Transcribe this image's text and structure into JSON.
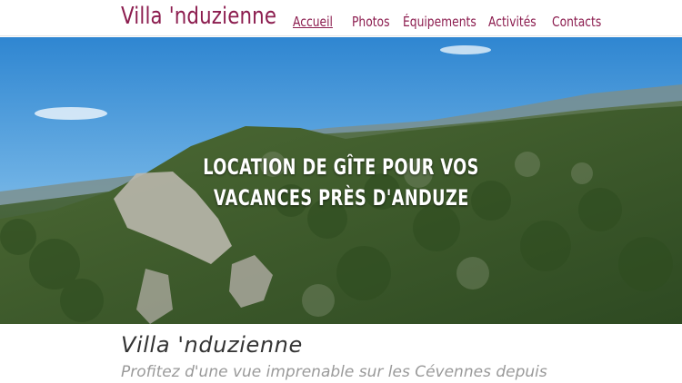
{
  "header": {
    "site_title": "Villa 'nduzienne",
    "nav": [
      {
        "label": "Accueil",
        "active": true
      },
      {
        "label": "Photos",
        "active": false
      },
      {
        "label": "Équipements",
        "active": false
      },
      {
        "label": "Activités",
        "active": false
      },
      {
        "label": "Contacts",
        "active": false
      }
    ]
  },
  "hero": {
    "title_line1": "LOCATION DE GÎTE POUR VOS",
    "title_line2": "VACANCES PRÈS D'ANDUZE"
  },
  "intro": {
    "title": "Villa 'nduzienne",
    "subtitle": "Profitez d'une vue imprenable sur les Cévennes depuis"
  },
  "colors": {
    "brand": "#8c1d4f",
    "hero_text": "#ffffff",
    "intro_title": "#333333",
    "intro_subtitle": "#9a9a9a"
  }
}
